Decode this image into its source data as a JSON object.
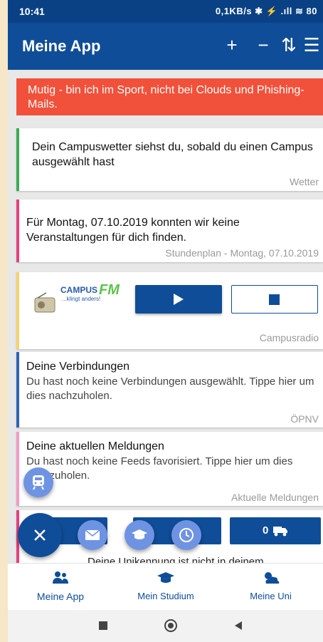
{
  "statusbar": {
    "time": "10:41",
    "right": "0,1KB/s ✱ ⚡ .ıll ≋ 80"
  },
  "appbar": {
    "title": "Meine App",
    "add_icon": "+",
    "remove_icon": "−",
    "sort_icon": "⇅",
    "filter_icon": "☰"
  },
  "alert": {
    "text": "Mutig - bin ich im Sport, nicht bei Clouds und Phishing-Mails."
  },
  "weather": {
    "text": "Dein Campuswetter siehst du, sobald du einen Campus ausgewählt hast",
    "footer": "Wetter"
  },
  "timetable": {
    "text": "Für Montag, 07.10.2019 konnten wir keine Veranstaltungen für dich finden.",
    "footer": "Stundenplan - Montag, 07.10.2019"
  },
  "radio": {
    "logo_text": "CAMPUS",
    "logo_fm": "FM",
    "logo_sub": "...klingt anders!",
    "footer": "Campusradio"
  },
  "transit": {
    "title": "Deine Verbindungen",
    "text": "Du hast noch keine Verbindungen ausgewählt. Tippe hier um dies nachzuholen.",
    "footer": "ÖPNV"
  },
  "news": {
    "title": "Deine aktuellen Meldungen",
    "text": "Du hast noch keine Feeds favorisiert. Tippe hier um dies nachzuholen.",
    "footer": "Aktuelle Meldungen"
  },
  "counters": {
    "c1": "0",
    "c2": "0",
    "c3": "0"
  },
  "partial_text": "Deine Unikennung ist nicht in deinem",
  "bottomnav": {
    "item1": "Meine App",
    "item2": "Mein Studium",
    "item3": "Meine Uni"
  },
  "colors": {
    "primary": "#0f4d98",
    "alert": "#f1513a",
    "fab": "#0f4d98",
    "fab_small": "#6f93e3"
  }
}
